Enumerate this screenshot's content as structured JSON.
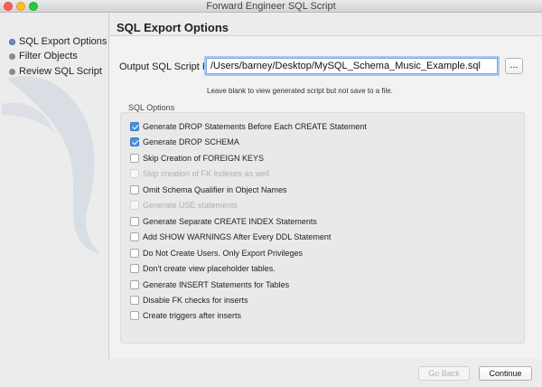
{
  "window": {
    "title": "Forward Engineer SQL Script"
  },
  "sidebar": {
    "steps": [
      {
        "label": "SQL Export Options",
        "active": true
      },
      {
        "label": "Filter Objects",
        "active": false
      },
      {
        "label": "Review SQL Script",
        "active": false
      }
    ]
  },
  "main": {
    "title": "SQL Export Options",
    "output": {
      "label": "Output SQL Script File:",
      "value": "/Users/barney/Desktop/MySQL_Schema_Music_Example.sql",
      "browse_label": "...",
      "hint": "Leave blank to view generated script but not save to a file."
    },
    "options_label": "SQL Options",
    "options": [
      {
        "label": "Generate DROP Statements Before Each CREATE Statement",
        "checked": true,
        "enabled": true
      },
      {
        "label": "Generate DROP SCHEMA",
        "checked": true,
        "enabled": true
      },
      {
        "label": "Skip Creation of FOREIGN KEYS",
        "checked": false,
        "enabled": true
      },
      {
        "label": "Skip creation of FK Indexes as well",
        "checked": false,
        "enabled": false
      },
      {
        "label": "Omit Schema Qualifier in Object Names",
        "checked": false,
        "enabled": true
      },
      {
        "label": "Generate USE statements",
        "checked": false,
        "enabled": false
      },
      {
        "label": "Generate Separate CREATE INDEX Statements",
        "checked": false,
        "enabled": true
      },
      {
        "label": "Add SHOW WARNINGS After Every DDL Statement",
        "checked": false,
        "enabled": true
      },
      {
        "label": "Do Not Create Users. Only Export Privileges",
        "checked": false,
        "enabled": true
      },
      {
        "label": "Don't create view placeholder tables.",
        "checked": false,
        "enabled": true
      },
      {
        "label": "Generate INSERT Statements for Tables",
        "checked": false,
        "enabled": true
      },
      {
        "label": "Disable FK checks for inserts",
        "checked": false,
        "enabled": true
      },
      {
        "label": "Create triggers after inserts",
        "checked": false,
        "enabled": true
      }
    ]
  },
  "footer": {
    "back_label": "Go Back",
    "continue_label": "Continue"
  },
  "colors": {
    "accent": "#4a90e2",
    "disabled_text": "#b0b0b0"
  }
}
